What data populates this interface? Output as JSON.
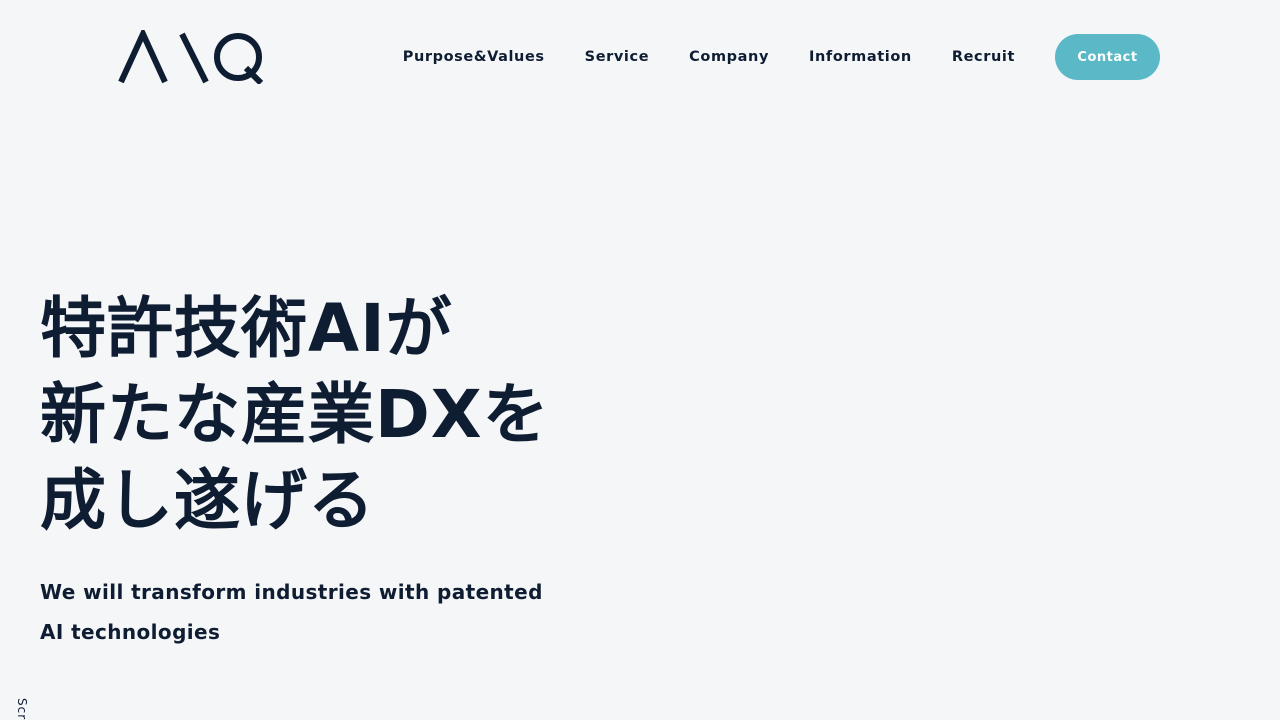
{
  "brand": {
    "logo_text": "AIQ",
    "text_color": "#0f1d33",
    "background_color": "#f4f6f8",
    "accent_color": "#5ab8c7"
  },
  "nav": {
    "items": [
      {
        "label": "Purpose&Values"
      },
      {
        "label": "Service"
      },
      {
        "label": "Company"
      },
      {
        "label": "Information"
      },
      {
        "label": "Recruit"
      }
    ],
    "contact_label": "Contact"
  },
  "hero": {
    "title_lines": [
      "特許技術AIが",
      "新たな産業DXを",
      "成し遂げる"
    ],
    "subtitle_lines": [
      "We will transform industries with patented",
      "AI technologies"
    ]
  },
  "scroll": {
    "label": "Scroll"
  }
}
